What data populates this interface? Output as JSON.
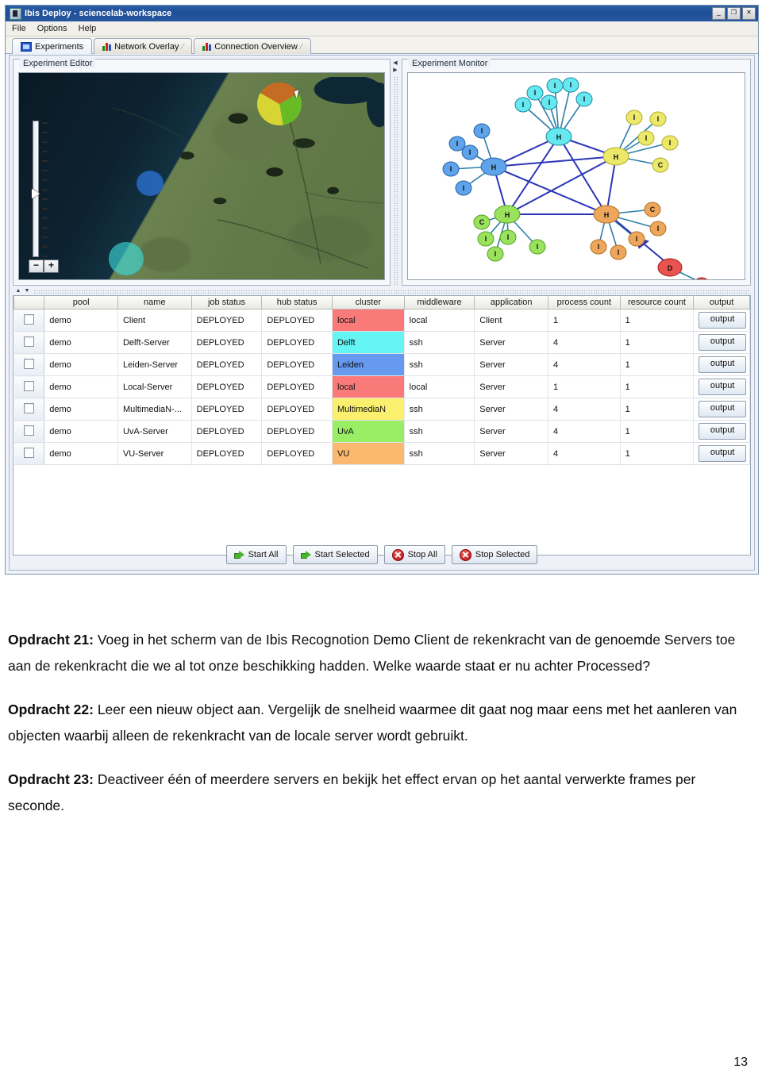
{
  "window": {
    "title": "Ibis Deploy - sciencelab-workspace",
    "minimize": "_",
    "maximize": "❐",
    "close": "✕"
  },
  "menu": {
    "items": [
      "File",
      "Options",
      "Help"
    ]
  },
  "tabs": [
    {
      "label": "Experiments",
      "icon": "experiments-icon",
      "selected": true,
      "pin": ""
    },
    {
      "label": "Network Overlay",
      "icon": "bar-chart-icon",
      "selected": false,
      "pin": "⁄"
    },
    {
      "label": "Connection Overview",
      "icon": "bar-chart-icon",
      "selected": false,
      "pin": "⁄"
    }
  ],
  "panels": {
    "editor": {
      "title": "Experiment Editor"
    },
    "monitor": {
      "title": "Experiment Monitor"
    }
  },
  "map": {
    "zoom_in_label": "+",
    "zoom_out_label": "−",
    "markers": [
      {
        "name": "pie-marker-multi-cluster",
        "colors": [
          "#d2691e",
          "#6ac421",
          "#e8e030"
        ]
      },
      {
        "name": "blue-circle-marker",
        "color": "#2d78e1"
      },
      {
        "name": "cyan-circle-marker",
        "color": "#3ce1e1"
      }
    ]
  },
  "graph": {
    "hub_letter": "H",
    "node_letters": {
      "ibis": "I",
      "client": "C",
      "deploy": "D"
    },
    "clusters": [
      {
        "name": "delft",
        "color": "#66e8f0",
        "hub": "H"
      },
      {
        "name": "leiden",
        "color": "#5fa3ea",
        "hub": "H"
      },
      {
        "name": "multimedian",
        "color": "#ece96a",
        "hub": "H"
      },
      {
        "name": "uva",
        "color": "#9ae25e",
        "hub": "H"
      },
      {
        "name": "vu",
        "color": "#eda65c",
        "hub": "H"
      },
      {
        "name": "local",
        "color": "#e8534f",
        "hub": "D"
      }
    ]
  },
  "table": {
    "columns": [
      "",
      "pool",
      "name",
      "job status",
      "hub status",
      "cluster",
      "middleware",
      "application",
      "process count",
      "resource count",
      "output"
    ],
    "rows": [
      {
        "selected": false,
        "pool": "demo",
        "name": "Client",
        "job_status": "DEPLOYED",
        "hub_status": "DEPLOYED",
        "cluster": "local",
        "cluster_color": "#fa7a7a",
        "middleware": "local",
        "application": "Client",
        "process_count": "1",
        "resource_count": "1",
        "output": "output"
      },
      {
        "selected": false,
        "pool": "demo",
        "name": "Delft-Server",
        "job_status": "DEPLOYED",
        "hub_status": "DEPLOYED",
        "cluster": "Delft",
        "cluster_color": "#66f5f5",
        "middleware": "ssh",
        "application": "Server",
        "process_count": "4",
        "resource_count": "1",
        "output": "output"
      },
      {
        "selected": false,
        "pool": "demo",
        "name": "Leiden-Server",
        "job_status": "DEPLOYED",
        "hub_status": "DEPLOYED",
        "cluster": "Leiden",
        "cluster_color": "#6699f0",
        "middleware": "ssh",
        "application": "Server",
        "process_count": "4",
        "resource_count": "1",
        "output": "output"
      },
      {
        "selected": false,
        "pool": "demo",
        "name": "Local-Server",
        "job_status": "DEPLOYED",
        "hub_status": "DEPLOYED",
        "cluster": "local",
        "cluster_color": "#fa7a7a",
        "middleware": "local",
        "application": "Server",
        "process_count": "1",
        "resource_count": "1",
        "output": "output"
      },
      {
        "selected": false,
        "pool": "demo",
        "name": "MultimediaN-...",
        "job_status": "DEPLOYED",
        "hub_status": "DEPLOYED",
        "cluster": "MultimediaN",
        "cluster_color": "#faf06e",
        "middleware": "ssh",
        "application": "Server",
        "process_count": "4",
        "resource_count": "1",
        "output": "output"
      },
      {
        "selected": false,
        "pool": "demo",
        "name": "UvA-Server",
        "job_status": "DEPLOYED",
        "hub_status": "DEPLOYED",
        "cluster": "UvA",
        "cluster_color": "#99ee66",
        "middleware": "ssh",
        "application": "Server",
        "process_count": "4",
        "resource_count": "1",
        "output": "output"
      },
      {
        "selected": false,
        "pool": "demo",
        "name": "VU-Server",
        "job_status": "DEPLOYED",
        "hub_status": "DEPLOYED",
        "cluster": "VU",
        "cluster_color": "#fab96e",
        "middleware": "ssh",
        "application": "Server",
        "process_count": "4",
        "resource_count": "1",
        "output": "output"
      }
    ]
  },
  "action_buttons": [
    {
      "label": "Start All",
      "icon": "green-arrow-icon"
    },
    {
      "label": "Start Selected",
      "icon": "green-arrow-icon"
    },
    {
      "label": "Stop All",
      "icon": "red-stop-icon"
    },
    {
      "label": "Stop Selected",
      "icon": "red-stop-icon"
    }
  ],
  "document": {
    "exercises": [
      {
        "label": "Opdracht 21:",
        "text": " Voeg in het scherm van de Ibis Recognotion Demo Client de rekenkracht van de genoemde Servers toe aan de rekenkracht die we al tot onze beschikking hadden. Welke waarde staat er nu achter Processed?"
      },
      {
        "label": "Opdracht 22:",
        "text": " Leer een nieuw object aan. Vergelijk de snelheid waarmee dit gaat nog maar eens met het aanleren van objecten waarbij alleen de rekenkracht van de locale server wordt gebruikt."
      },
      {
        "label": "Opdracht 23:",
        "text": " Deactiveer één of meerdere servers en bekijk het effect ervan op het aantal verwerkte frames per seconde."
      }
    ],
    "page_number": "13"
  },
  "colors": {
    "titlebar": "#1d4e96",
    "deployed_text": "#2f9e2f",
    "panel_bg": "#eef2f8"
  }
}
